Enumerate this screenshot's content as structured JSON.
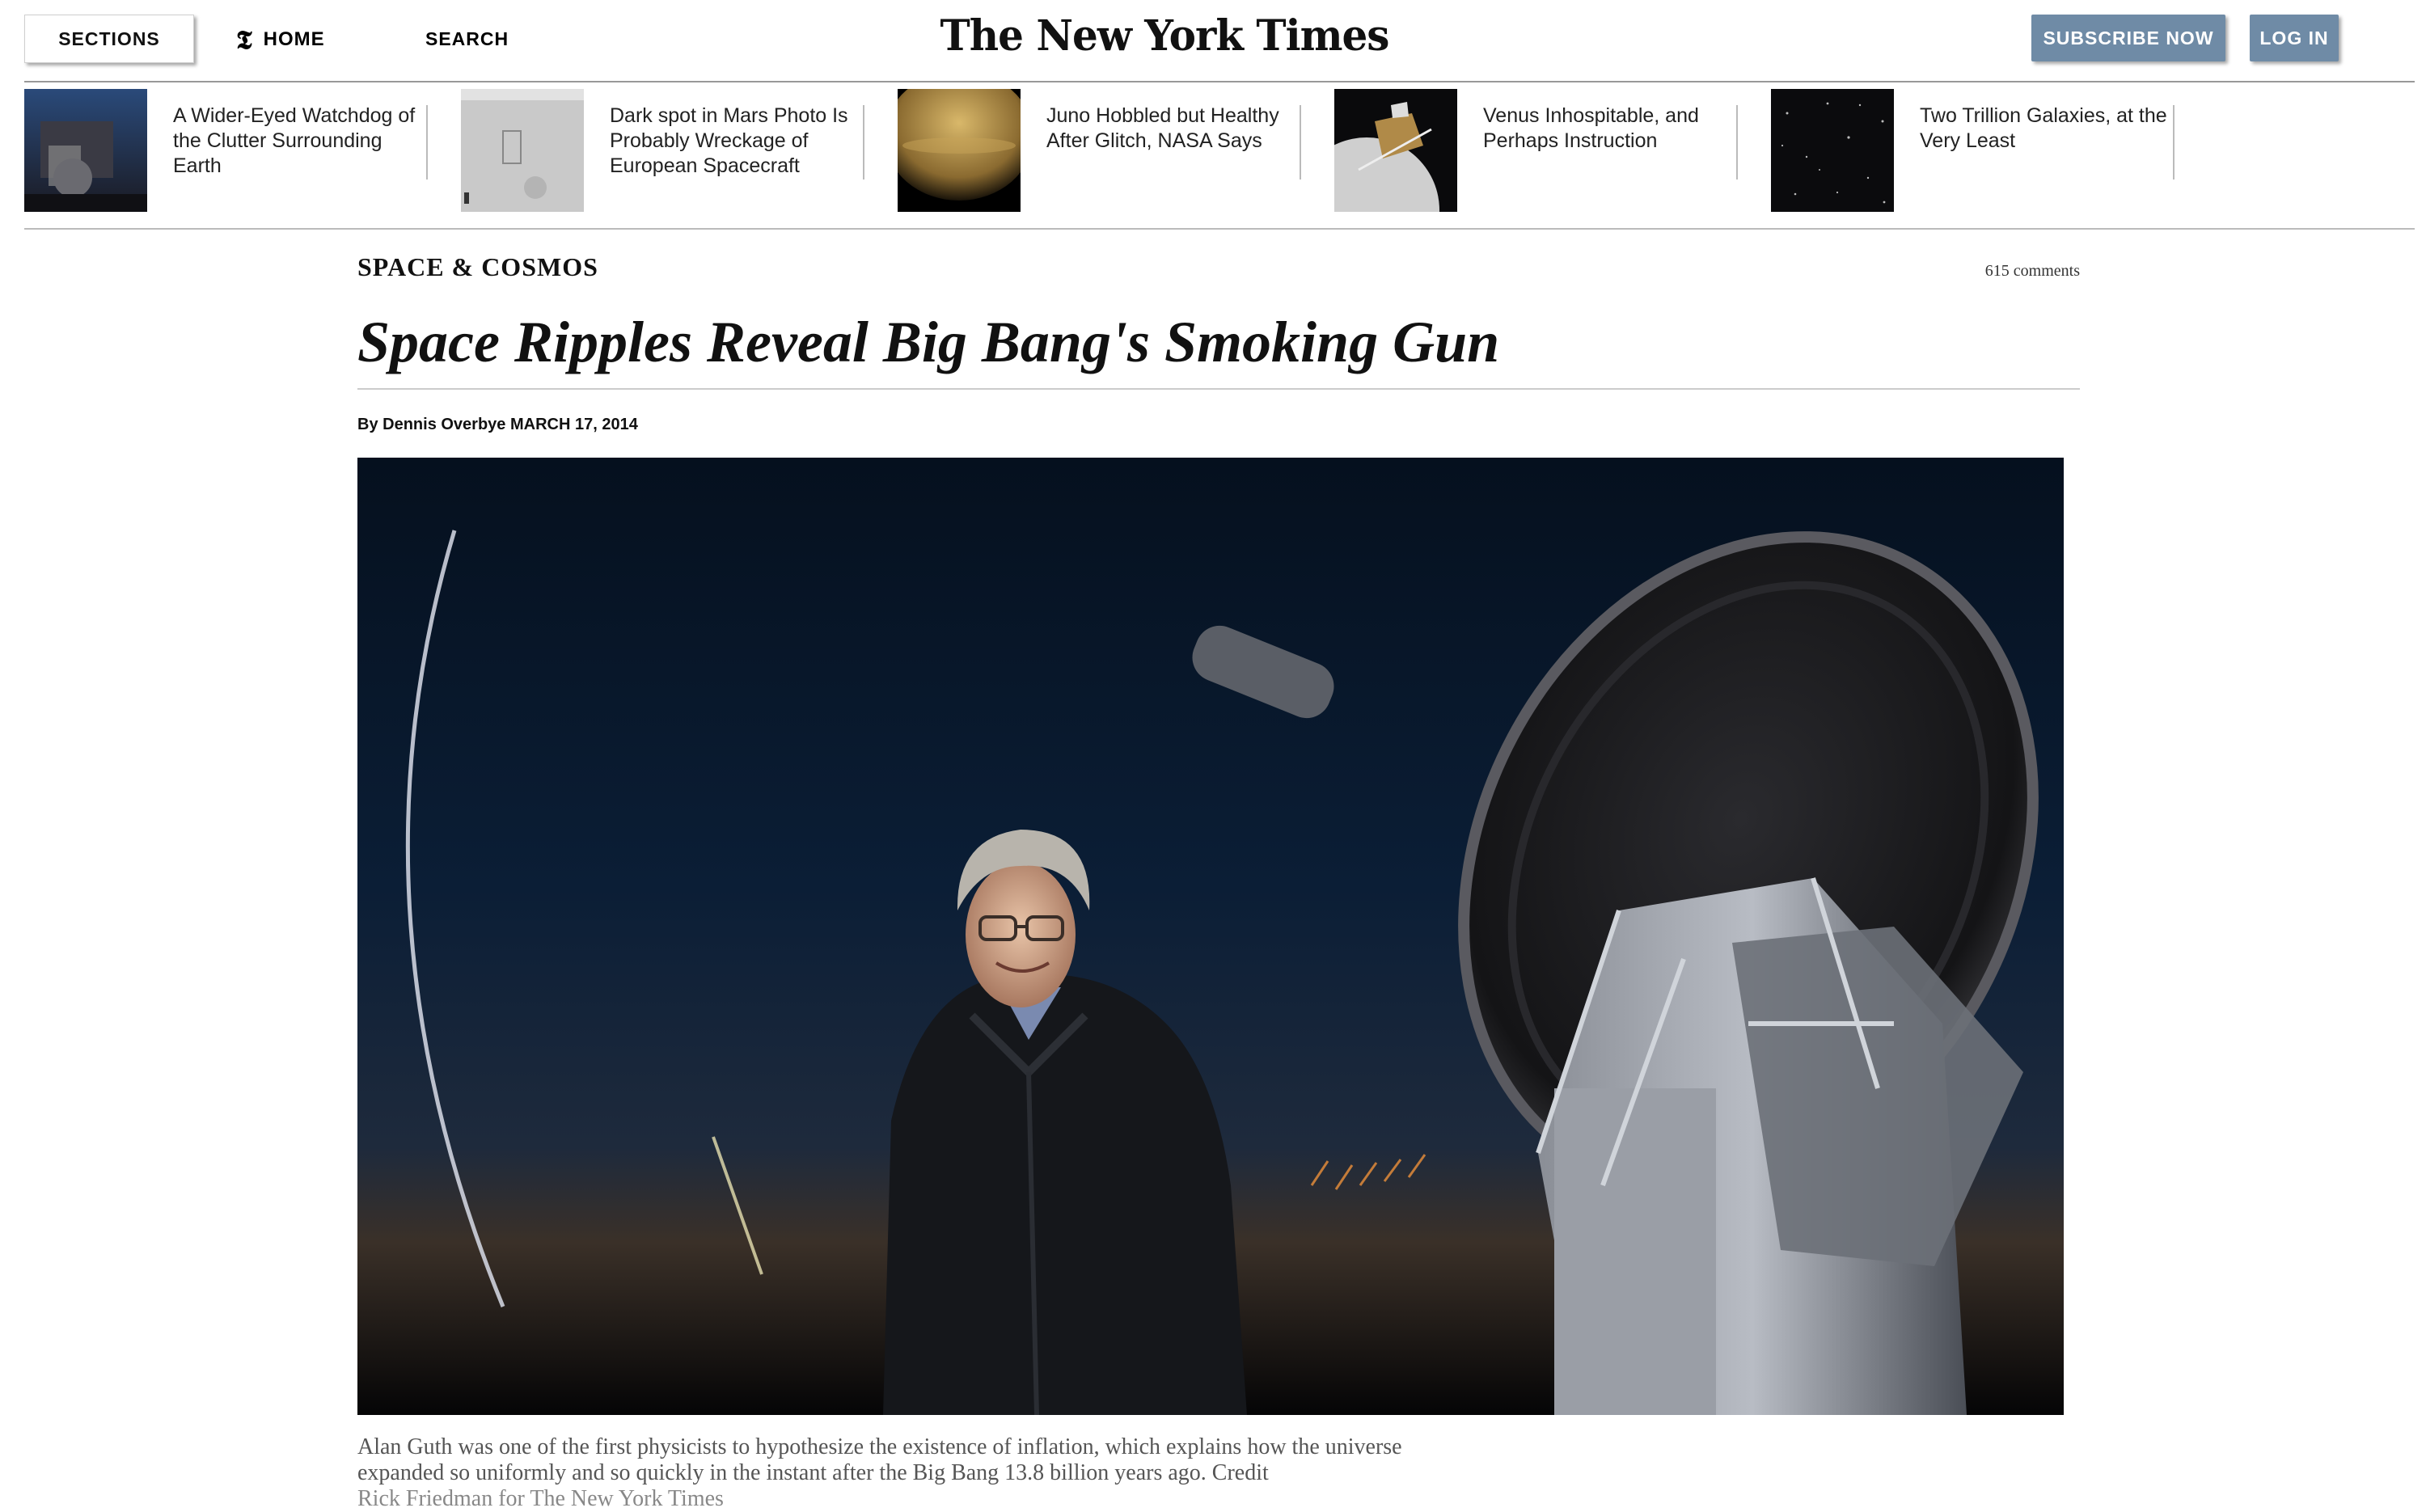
{
  "header": {
    "sections_label": "SECTIONS",
    "home_label": "HOME",
    "home_icon": "nyt-t-icon",
    "home_glyph": "𝕿",
    "search_label": "SEARCH",
    "logo_text": "The New York Times",
    "subscribe_label": "SUBSCRIBE NOW",
    "login_label": "LOG IN",
    "button_color": "#6f8ba6"
  },
  "related": [
    {
      "headline": "A Wider-Eyed Watchdog of the Clutter Surrounding Earth"
    },
    {
      "headline": "Dark spot in Mars Photo Is Probably Wreckage of European Spacecraft"
    },
    {
      "headline": "Juno Hobbled but Healthy After Glitch, NASA Says"
    },
    {
      "headline": "Venus Inhospitable, and Perhaps Instruction"
    },
    {
      "headline": "Two Trillion Galaxies, at the Very Least"
    }
  ],
  "article": {
    "kicker": "SPACE & COSMOS",
    "comments": "615 comments",
    "headline": "Space Ripples Reveal Big Bang's Smoking Gun",
    "byline_prefix": "By",
    "author": "Dennis Overbye",
    "date": "MARCH 17, 2014",
    "caption": "Alan Guth was one of the first physicists to hypothesize the existence of inflation, which explains how the universe expanded so uniformly and so quickly in the instant after the Big Bang 13.8 billion years ago.",
    "credit_label": "Credit",
    "credit": "Rick Friedman for The New York Times"
  }
}
